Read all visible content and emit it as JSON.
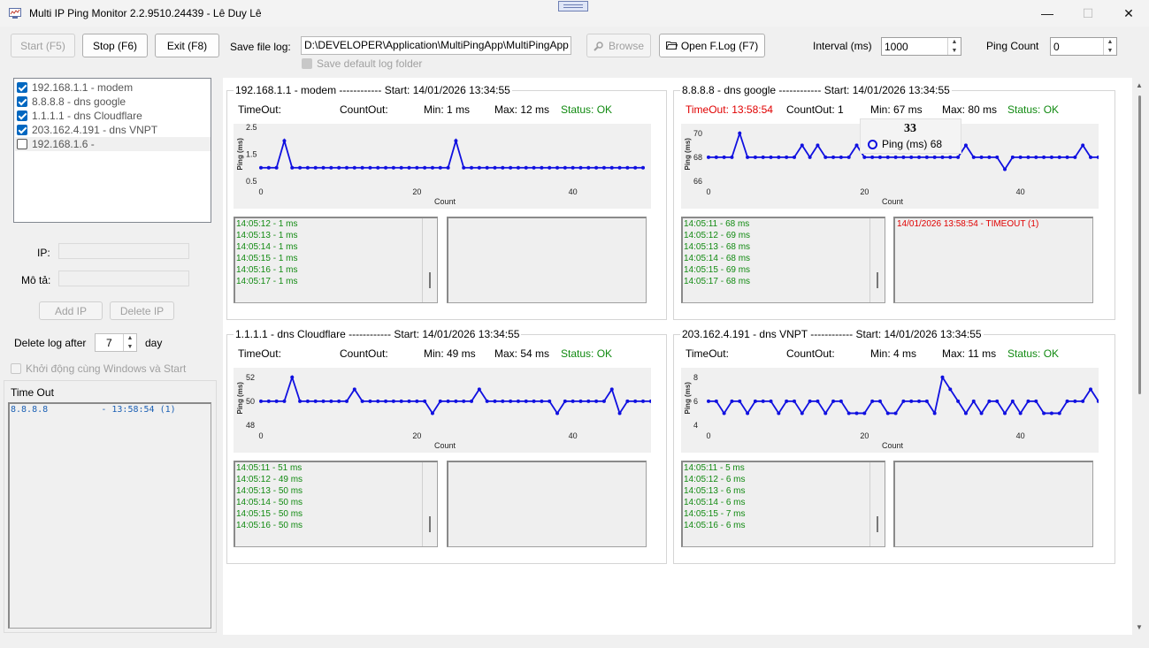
{
  "window": {
    "title": "Multi IP Ping Monitor 2.2.9510.24439 - Lê Duy Lê",
    "minimize": "—",
    "maximize": "☐",
    "close": "✕"
  },
  "toolbar": {
    "start_label": "Start (F5)",
    "stop_label": "Stop (F6)",
    "exit_label": "Exit (F8)",
    "save_file_log_label": "Save file log:",
    "log_path": "D:\\DEVELOPER\\Application\\MultiPingApp\\MultiPingApp",
    "save_default_label": "Save default log folder",
    "browse_label": "Browse",
    "open_log_label": "Open F.Log (F7)",
    "interval_label": "Interval (ms)",
    "interval_value": "1000",
    "ping_count_label": "Ping Count",
    "ping_count_value": "0"
  },
  "sidebar": {
    "hosts": [
      {
        "label": "192.168.1.1 - modem",
        "checked": true
      },
      {
        "label": "8.8.8.8 - dns google",
        "checked": true
      },
      {
        "label": "1.1.1.1 - dns Cloudflare",
        "checked": true
      },
      {
        "label": "203.162.4.191 - dns VNPT",
        "checked": true
      },
      {
        "label": "192.168.1.6 -",
        "checked": false
      }
    ],
    "ip_label": "IP:",
    "desc_label": "Mô tả:",
    "add_ip_label": "Add IP",
    "delete_ip_label": "Delete IP",
    "delete_log_label": "Delete log after",
    "delete_log_value": "7",
    "day_label": "day",
    "autostart_label": "Khởi động cùng Windows và Start",
    "timeout_title": "Time Out",
    "timeout_entry": "8.8.8.8          - 13:58:54 (1)"
  },
  "panels": [
    {
      "header": "192.168.1.1  -  modem  ------------   Start: 14/01/2026  13:34:55",
      "timeout": "TimeOut:",
      "countout": "CountOut:",
      "min": "Min: 1 ms",
      "max": "Max: 12 ms",
      "status": "Status: OK",
      "log": [
        "14:05:12 - 1 ms",
        "14:05:13 - 1 ms",
        "14:05:14 - 1 ms",
        "14:05:15 - 1 ms",
        "14:05:16 - 1 ms",
        "14:05:17 - 1 ms"
      ],
      "timeout_log": []
    },
    {
      "header": "8.8.8.8  -  dns google  ------------   Start: 14/01/2026  13:34:55",
      "timeout": "TimeOut: 13:58:54",
      "countout": "CountOut: 1",
      "min": "Min: 67 ms",
      "max": "Max: 80 ms",
      "status": "Status: OK",
      "log": [
        "14:05:11 - 68 ms",
        "14:05:12 - 69 ms",
        "14:05:13 - 68 ms",
        "14:05:14 - 68 ms",
        "14:05:15 - 69 ms",
        "14:05:17 - 68 ms"
      ],
      "timeout_log": [
        "14/01/2026  13:58:54 -  TIMEOUT (1)"
      ]
    },
    {
      "header": "1.1.1.1  -  dns Cloudflare  ------------   Start: 14/01/2026  13:34:55",
      "timeout": "TimeOut:",
      "countout": "CountOut:",
      "min": "Min: 49 ms",
      "max": "Max: 54 ms",
      "status": "Status: OK",
      "log": [
        "14:05:11 - 51 ms",
        "14:05:12 - 49 ms",
        "14:05:13 - 50 ms",
        "14:05:14 - 50 ms",
        "14:05:15 - 50 ms",
        "14:05:16 - 50 ms"
      ],
      "timeout_log": []
    },
    {
      "header": "203.162.4.191  -  dns VNPT  ------------   Start: 14/01/2026  13:34:55",
      "timeout": "TimeOut:",
      "countout": "CountOut:",
      "min": "Min: 4 ms",
      "max": "Max: 11 ms",
      "status": "Status: OK",
      "log": [
        "14:05:11 - 5 ms",
        "14:05:12 - 6 ms",
        "14:05:13 - 6 ms",
        "14:05:14 - 6 ms",
        "14:05:15 - 7 ms",
        "14:05:16 - 6 ms"
      ],
      "timeout_log": []
    }
  ],
  "tooltip": {
    "title": "33",
    "series": "Ping (ms)",
    "value": "68"
  },
  "colors": {
    "series": "#1010e0",
    "ok": "#118a11",
    "timeout": "#e00000",
    "check_accent": "#0067c0"
  },
  "chart_data": [
    {
      "type": "line",
      "ylabel": "Ping (ms)",
      "xlabel": "Count",
      "xticks": [
        0,
        20,
        40
      ],
      "yticks": [
        "0.5",
        "1.5",
        "2.5"
      ],
      "ylim": [
        0.5,
        2.5
      ],
      "xlim": [
        0,
        49
      ],
      "series": [
        {
          "values": [
            1,
            1,
            1,
            2,
            1,
            1,
            1,
            1,
            1,
            1,
            1,
            1,
            1,
            1,
            1,
            1,
            1,
            1,
            1,
            1,
            1,
            1,
            1,
            1,
            1,
            2,
            1,
            1,
            1,
            1,
            1,
            1,
            1,
            1,
            1,
            1,
            1,
            1,
            1,
            1,
            1,
            1,
            1,
            1,
            1,
            1,
            1,
            1,
            1,
            1
          ]
        }
      ]
    },
    {
      "type": "line",
      "ylabel": "Ping (ms)",
      "xlabel": "Count",
      "xticks": [
        0,
        20,
        40
      ],
      "yticks": [
        "66",
        "68",
        "70"
      ],
      "ylim": [
        66,
        70.5
      ],
      "xlim": [
        0,
        49
      ],
      "series": [
        {
          "values": [
            68,
            68,
            68,
            68,
            70,
            68,
            68,
            68,
            68,
            68,
            68,
            68,
            69,
            68,
            69,
            68,
            68,
            68,
            68,
            69,
            68,
            68,
            68,
            68,
            68,
            68,
            68,
            68,
            68,
            68,
            68,
            68,
            68,
            69,
            68,
            68,
            68,
            68,
            67,
            68,
            68,
            68,
            68,
            68,
            68,
            68,
            68,
            68,
            69,
            68,
            68,
            69
          ]
        }
      ]
    },
    {
      "type": "line",
      "ylabel": "Ping (ms)",
      "xlabel": "Count",
      "xticks": [
        0,
        20,
        40
      ],
      "yticks": [
        "48",
        "50",
        "52"
      ],
      "ylim": [
        48,
        52.5
      ],
      "xlim": [
        0,
        49
      ],
      "series": [
        {
          "values": [
            50,
            50,
            50,
            50,
            52,
            50,
            50,
            50,
            50,
            50,
            50,
            50,
            51,
            50,
            50,
            50,
            50,
            50,
            50,
            50,
            50,
            50,
            49,
            50,
            50,
            50,
            50,
            50,
            51,
            50,
            50,
            50,
            50,
            50,
            50,
            50,
            50,
            50,
            49,
            50,
            50,
            50,
            50,
            50,
            50,
            51,
            49,
            50,
            50,
            50,
            50,
            50
          ]
        }
      ]
    },
    {
      "type": "line",
      "ylabel": "Ping (ms)",
      "xlabel": "Count",
      "xticks": [
        0,
        20,
        40
      ],
      "yticks": [
        "4",
        "6",
        "8"
      ],
      "ylim": [
        4,
        8.5
      ],
      "xlim": [
        0,
        49
      ],
      "series": [
        {
          "values": [
            6,
            6,
            5,
            6,
            6,
            5,
            6,
            6,
            6,
            5,
            6,
            6,
            5,
            6,
            6,
            5,
            6,
            6,
            5,
            5,
            5,
            6,
            6,
            5,
            5,
            6,
            6,
            6,
            6,
            5,
            8,
            7,
            6,
            5,
            6,
            5,
            6,
            6,
            5,
            6,
            5,
            6,
            6,
            5,
            5,
            5,
            6,
            6,
            6,
            7,
            6
          ]
        }
      ]
    }
  ]
}
